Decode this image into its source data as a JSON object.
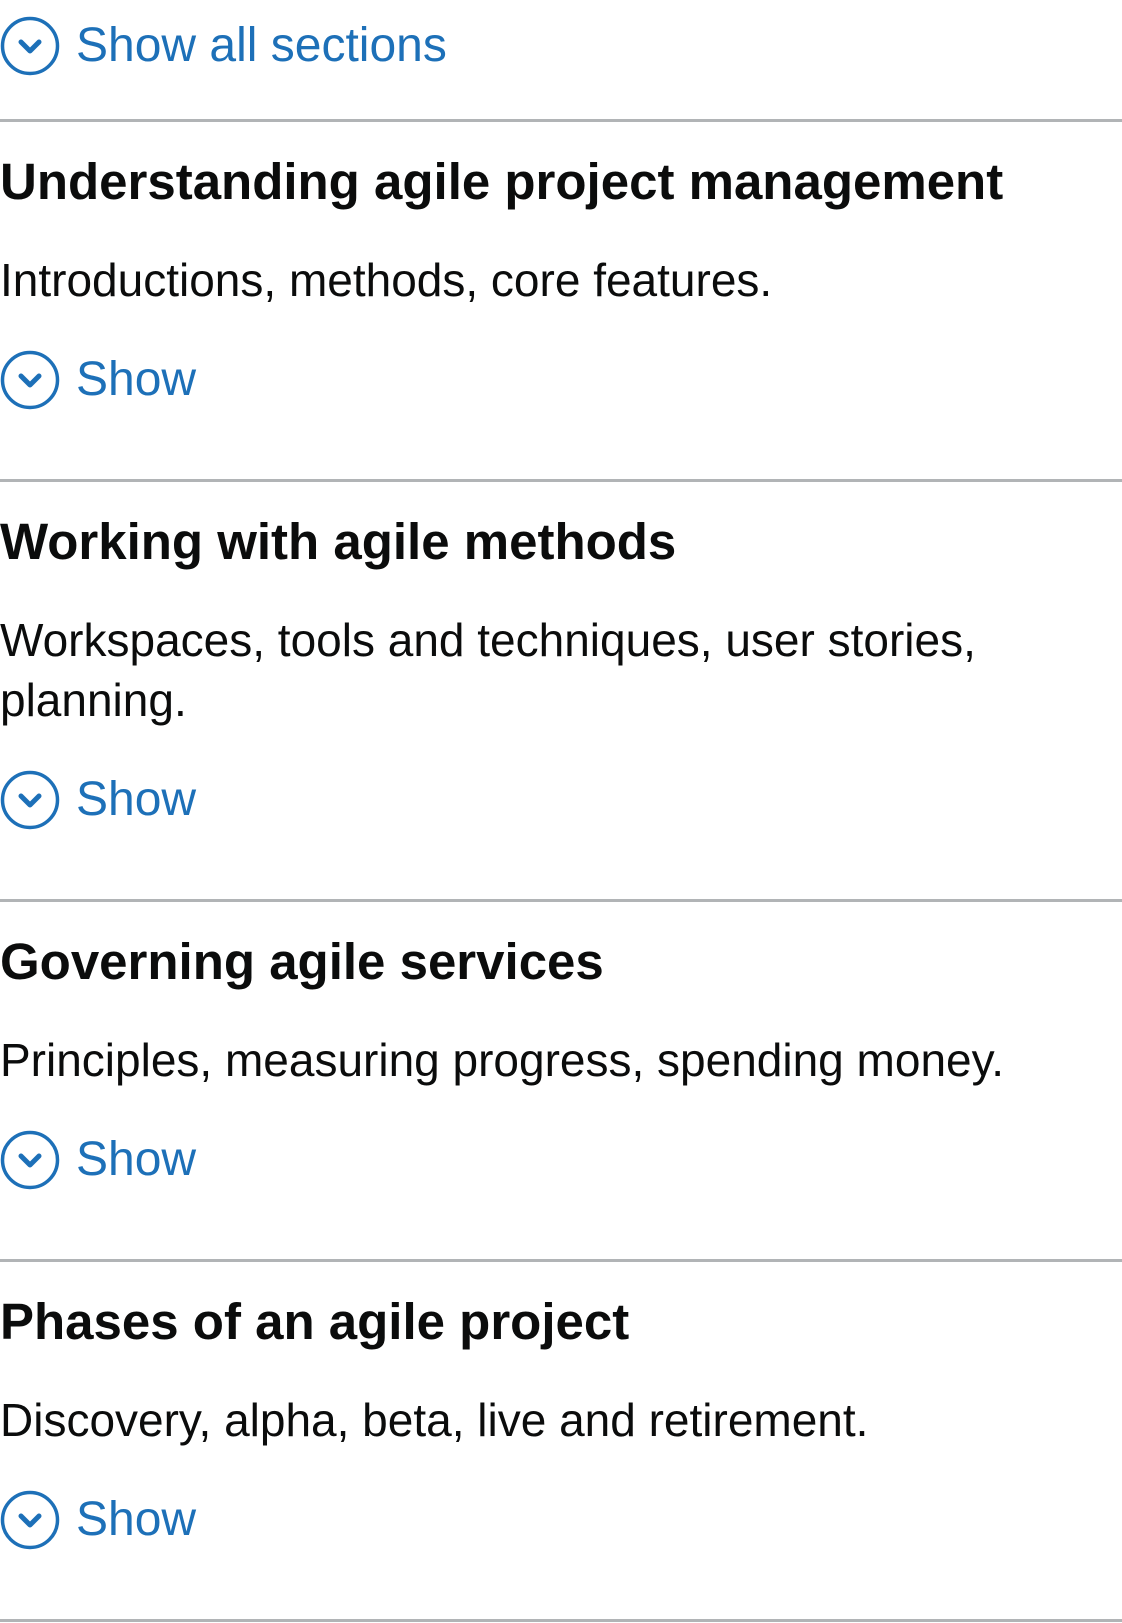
{
  "show_all": {
    "label": "Show all sections",
    "icon": "chevron-down-circle-icon"
  },
  "sections": [
    {
      "heading": "Understanding agile project management",
      "summary": "Introductions, methods, core features.",
      "toggle_label": "Show"
    },
    {
      "heading": "Working with agile methods",
      "summary": "Workspaces, tools and techniques, user stories, planning.",
      "toggle_label": "Show"
    },
    {
      "heading": "Governing agile services",
      "summary": "Principles, measuring progress, spending money.",
      "toggle_label": "Show"
    },
    {
      "heading": "Phases of an agile project",
      "summary": "Discovery, alpha, beta, live and retirement.",
      "toggle_label": "Show"
    }
  ],
  "colors": {
    "link": "#1d70b8",
    "text": "#0b0c0c",
    "rule": "#b1b4b6"
  }
}
